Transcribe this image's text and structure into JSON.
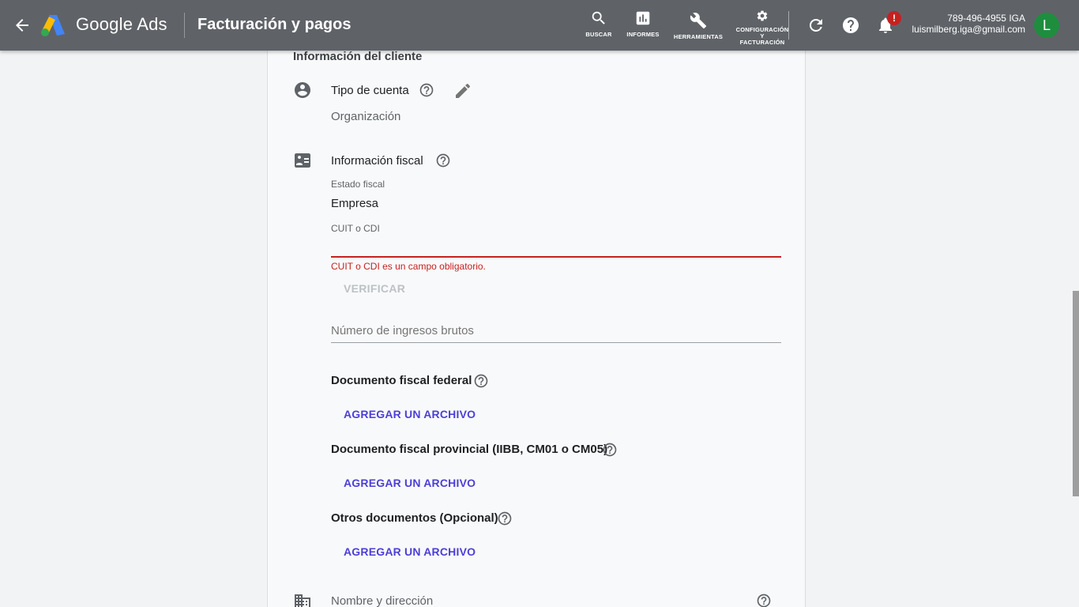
{
  "header": {
    "product_name": "Google Ads",
    "page_title": "Facturación y pagos",
    "nav": [
      {
        "label": "BUSCAR",
        "icon": "search-icon"
      },
      {
        "label": "INFORMES",
        "icon": "reports-icon"
      },
      {
        "label": "HERRAMIENTAS",
        "icon": "wrench-icon"
      },
      {
        "label_lines": [
          "CONFIGURACIÓN",
          "Y",
          "FACTURACIÓN"
        ],
        "icon": "gear-icon"
      }
    ],
    "notification_badge": "!",
    "account_id": "789-496-4955 IGA",
    "account_email": "luismilberg.iga@gmail.com",
    "avatar_letter": "L"
  },
  "card": {
    "section_title": "Información del cliente",
    "account_type": {
      "label": "Tipo de cuenta",
      "value": "Organización"
    },
    "fiscal_info": {
      "label": "Información fiscal",
      "fiscal_status_label": "Estado fiscal",
      "fiscal_status_value": "Empresa",
      "cuit_label": "CUIT o CDI",
      "cuit_value": "",
      "cuit_error": "CUIT o CDI es un campo obligatorio.",
      "verify_button": "VERIFICAR",
      "gross_income_placeholder": "Número de ingresos brutos"
    },
    "documents": [
      {
        "title": "Documento fiscal federal",
        "action": "AGREGAR UN ARCHIVO"
      },
      {
        "title": "Documento fiscal provincial (IIBB, CM01 o CM05)",
        "action": "AGREGAR UN ARCHIVO"
      },
      {
        "title": "Otros documentos (Opcional)",
        "action": "AGREGAR UN ARCHIVO"
      }
    ],
    "name_address_label": "Nombre y dirección"
  },
  "colors": {
    "topbar": "#5f6368",
    "error": "#c5221f",
    "link": "#4c3fd8",
    "avatar": "#1e8e3e"
  }
}
